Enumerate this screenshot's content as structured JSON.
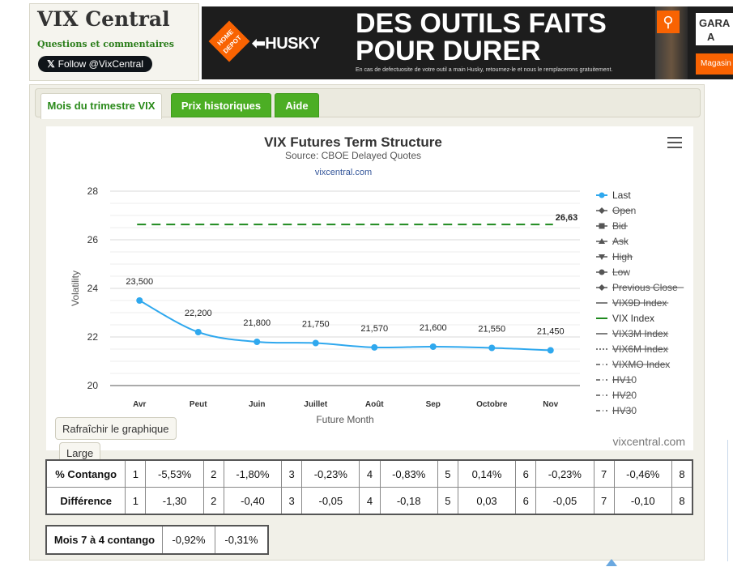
{
  "header": {
    "title": "VIX Central",
    "subtitle": "Questions et commentaires",
    "follow_label": "Follow @VixCentral",
    "follow_icon": "x-logo-icon"
  },
  "ad": {
    "store_logo": "HOME DEPOT",
    "brand": "HUSKY",
    "headline_1": "DES OUTILS FAITS",
    "headline_2": "POUR DURER",
    "fineprint": "En cas de defectuosite de votre outil a main Husky, retournez-le et nous le remplacerons gratuitement.",
    "side_text_1": "GARA",
    "side_text_2": "A",
    "shop_label": "Magasin",
    "pin_icon": "location-pin-icon"
  },
  "tabs": [
    {
      "label": "Mois du trimestre VIX",
      "active": true
    },
    {
      "label": "Prix historiques",
      "active": false
    },
    {
      "label": "Aide",
      "active": false
    }
  ],
  "chart_data": {
    "type": "line",
    "title": "VIX Futures Term Structure",
    "subtitle": "Source: CBOE Delayed Quotes",
    "site_label": "vixcentral.com",
    "credit": "vixcentral.com",
    "xlabel": "Future Month",
    "ylabel": "Volatility",
    "ylim": [
      20,
      28
    ],
    "yticks": [
      20,
      22,
      24,
      26,
      28
    ],
    "categories": [
      "Avr",
      "Peut",
      "Juin",
      "Juillet",
      "Août",
      "Sep",
      "Octobre",
      "Nov"
    ],
    "series": [
      {
        "name": "Last",
        "values": [
          23.5,
          22.2,
          21.8,
          21.75,
          21.57,
          21.6,
          21.55,
          21.45
        ],
        "labels": [
          "23,500",
          "22,200",
          "21,800",
          "21,750",
          "21,570",
          "21,600",
          "21,550",
          "21,450"
        ],
        "color": "#2fa8ee"
      },
      {
        "name": "VIX Index",
        "value": 26.63,
        "label": "26,63",
        "color": "#1f8a1f",
        "dashed": true
      }
    ],
    "grid": true,
    "legend_position": "right",
    "legend": [
      {
        "name": "Last",
        "marker": "circle",
        "line": "solid",
        "enabled": true,
        "color": "#2fa8ee"
      },
      {
        "name": "Open",
        "marker": "diamond",
        "line": "solid",
        "enabled": false
      },
      {
        "name": "Bid",
        "marker": "square",
        "line": "solid",
        "enabled": false
      },
      {
        "name": "Ask",
        "marker": "triangle-up",
        "line": "solid",
        "enabled": false
      },
      {
        "name": "High",
        "marker": "triangle-down",
        "line": "solid",
        "enabled": false
      },
      {
        "name": "Low",
        "marker": "circle",
        "line": "solid",
        "enabled": false
      },
      {
        "name": "Previous Close",
        "marker": "diamond",
        "line": "solid",
        "enabled": false
      },
      {
        "name": "VIX9D Index",
        "marker": "none",
        "line": "solid",
        "enabled": false
      },
      {
        "name": "VIX Index",
        "marker": "none",
        "line": "solid",
        "enabled": true,
        "color": "#1f8a1f"
      },
      {
        "name": "VIX3M Index",
        "marker": "none",
        "line": "solid",
        "enabled": false
      },
      {
        "name": "VIX6M Index",
        "marker": "none",
        "line": "dotted",
        "enabled": false
      },
      {
        "name": "VIXMO Index",
        "marker": "none",
        "line": "dashdot",
        "enabled": false
      },
      {
        "name": "HV10",
        "marker": "none",
        "line": "dashdot",
        "enabled": false
      },
      {
        "name": "HV20",
        "marker": "none",
        "line": "dashdot",
        "enabled": false
      },
      {
        "name": "HV30",
        "marker": "none",
        "line": "dashdot",
        "enabled": false
      }
    ],
    "menu_icon": "hamburger-menu-icon"
  },
  "buttons": {
    "refresh": "Rafraîchir le graphique",
    "large": "Large"
  },
  "contango_table": {
    "rows": [
      {
        "header": "% Contango",
        "cells": [
          [
            "1",
            "-5,53%"
          ],
          [
            "2",
            "-1,80%"
          ],
          [
            "3",
            "-0,23%"
          ],
          [
            "4",
            "-0,83%"
          ],
          [
            "5",
            "0,14%"
          ],
          [
            "6",
            "-0,23%"
          ],
          [
            "7",
            "-0,46%"
          ],
          [
            "8",
            ""
          ]
        ]
      },
      {
        "header": "Différence",
        "cells": [
          [
            "1",
            "-1,30"
          ],
          [
            "2",
            "-0,40"
          ],
          [
            "3",
            "-0,05"
          ],
          [
            "4",
            "-0,18"
          ],
          [
            "5",
            "0,03"
          ],
          [
            "6",
            "-0,05"
          ],
          [
            "7",
            "-0,10"
          ],
          [
            "8",
            ""
          ]
        ]
      }
    ]
  },
  "month7to4": {
    "label": "Mois 7 à 4 contango",
    "values": [
      "-0,92%",
      "-0,31%"
    ]
  }
}
